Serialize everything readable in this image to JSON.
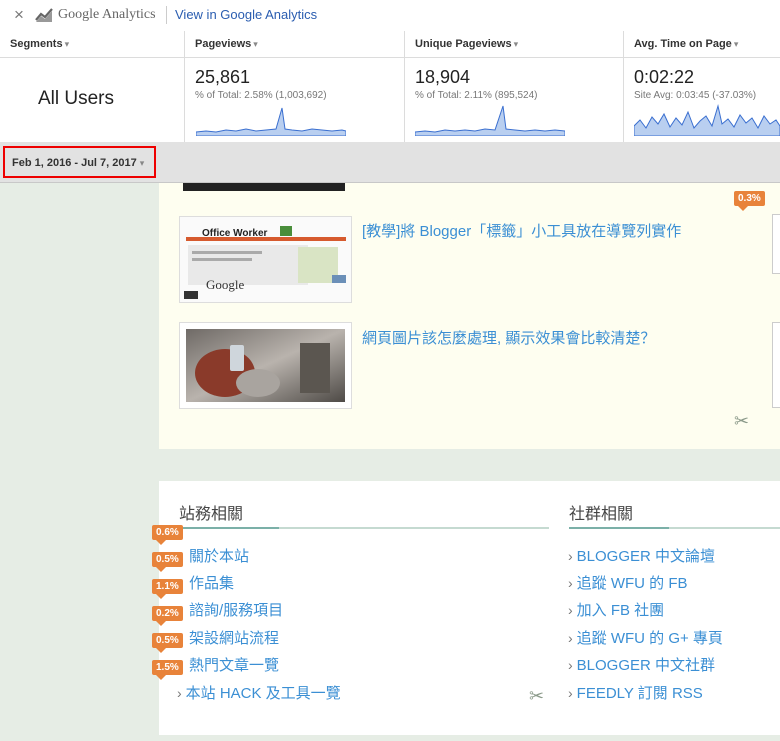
{
  "ga": {
    "close_icon": "×",
    "brand": "Google Analytics",
    "view_link": "View in Google Analytics",
    "columns": {
      "segments": "Segments",
      "pageviews": "Pageviews",
      "unique": "Unique Pageviews",
      "avg_time": "Avg. Time on Page"
    },
    "segment_name": "All Users",
    "metrics": {
      "pageviews": {
        "value": "25,861",
        "sub": "% of Total: 2.58% (1,003,692)"
      },
      "unique": {
        "value": "18,904",
        "sub": "% of Total: 2.11% (895,524)"
      },
      "avg_time": {
        "value": "0:02:22",
        "sub": "Site Avg: 0:03:45 (-37.03%)"
      }
    },
    "date_range": "Feb 1, 2016 - Jul 7, 2017",
    "accent_color": "#2a5db0",
    "highlight_color": "#ee0000"
  },
  "blog": {
    "top_badge": "0.3%",
    "posts": [
      {
        "title": "[教學]將 Blogger「標籤」小工具放在導覽列實作",
        "thumb_caption_1": "Office Worker",
        "thumb_caption_2": "Google"
      },
      {
        "title": "網頁圖片該怎麼處理, 顯示效果會比較清楚？"
      }
    ],
    "site_section": {
      "title": "站務相關",
      "items": [
        {
          "badge": "0.6%",
          "label": "關於本站"
        },
        {
          "badge": "0.5%",
          "label": "作品集"
        },
        {
          "badge": "1.1%",
          "label": "諮詢/服務項目"
        },
        {
          "badge": "0.2%",
          "label": "架設網站流程"
        },
        {
          "badge": "0.5%",
          "label": "熱門文章一覽"
        },
        {
          "badge": "1.5%",
          "label": "本站 HACK 及工具一覽"
        }
      ]
    },
    "community_section": {
      "title": "社群相關",
      "items": [
        {
          "label": "BLOGGER 中文論壇"
        },
        {
          "label": "追蹤 WFU 的 FB"
        },
        {
          "label": "加入 FB 社團"
        },
        {
          "label": "追蹤 WFU 的 G+ 專頁"
        },
        {
          "label": "BLOGGER 中文社群"
        },
        {
          "label": "FEEDLY 訂閱 RSS"
        }
      ]
    },
    "badge_color": "#e8833a",
    "link_color": "#3b8fd4",
    "chevron": "›",
    "tools_icon": "wrench-screwdriver-icon"
  }
}
